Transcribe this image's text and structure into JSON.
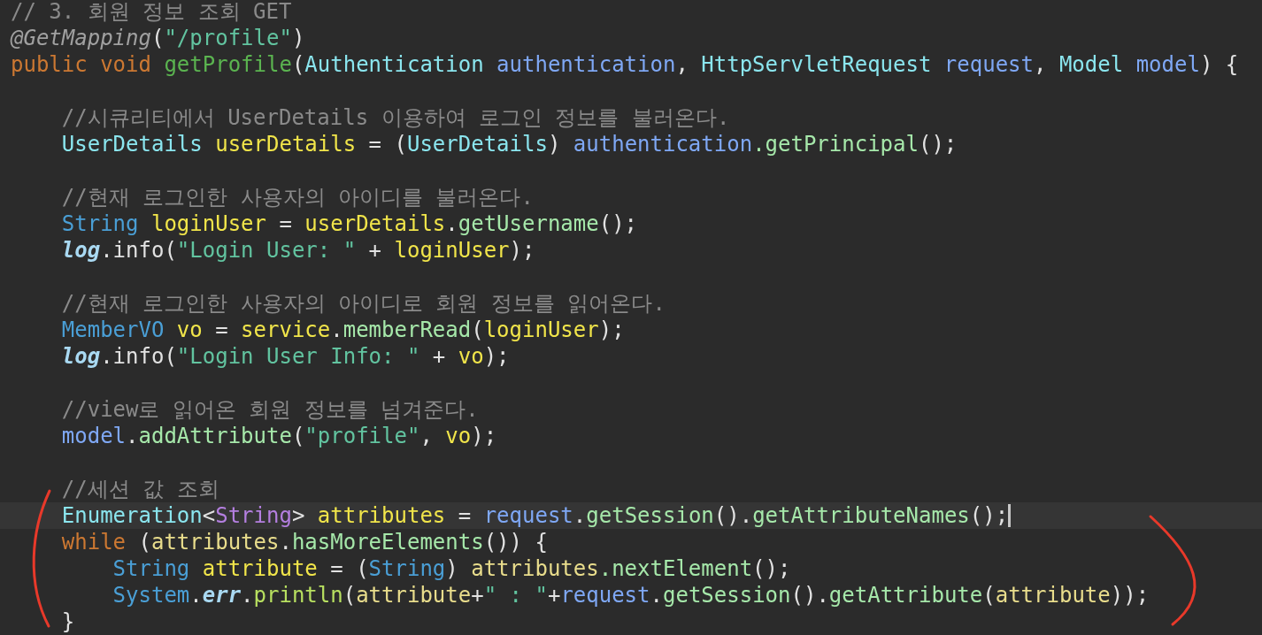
{
  "editor": {
    "lines": [
      {
        "kind": "code",
        "current": false,
        "tokens": [
          {
            "t": "// 3. 회원 정보 조회 GET",
            "kind": "cm"
          }
        ]
      },
      {
        "kind": "code",
        "current": false,
        "tokens": [
          {
            "t": "@GetMapping",
            "kind": "an"
          },
          {
            "t": "(",
            "kind": "p"
          },
          {
            "t": "\"/profile\"",
            "kind": "s"
          },
          {
            "t": ")",
            "kind": "p"
          }
        ]
      },
      {
        "kind": "code",
        "current": false,
        "tokens": [
          {
            "t": "public void",
            "kind": "kw"
          },
          {
            "t": " getProfile",
            "kind": "fn"
          },
          {
            "t": "(",
            "kind": "p"
          },
          {
            "t": "Authentication",
            "kind": "ty"
          },
          {
            "t": " authentication",
            "kind": "pa"
          },
          {
            "t": ",",
            "kind": "p"
          },
          {
            "t": " HttpServletRequest",
            "kind": "ty"
          },
          {
            "t": " request",
            "kind": "pa"
          },
          {
            "t": ",",
            "kind": "p"
          },
          {
            "t": " Model",
            "kind": "ty"
          },
          {
            "t": " model",
            "kind": "pa"
          },
          {
            "t": ") {",
            "kind": "p"
          }
        ]
      },
      {
        "kind": "blank",
        "current": false
      },
      {
        "kind": "code",
        "current": false,
        "tokens": [
          {
            "t": "    //시큐리티에서 UserDetails 이용하여 로그인 정보를 불러온다.",
            "kind": "cm"
          }
        ]
      },
      {
        "kind": "code",
        "current": false,
        "tokens": [
          {
            "t": "    UserDetails",
            "kind": "ty"
          },
          {
            "t": " userDetails",
            "kind": "lv"
          },
          {
            "t": " = (",
            "kind": "p"
          },
          {
            "t": "UserDetails",
            "kind": "ty"
          },
          {
            "t": ")",
            "kind": "p"
          },
          {
            "t": " authentication",
            "kind": "pa"
          },
          {
            "t": ".getPrincipal",
            "kind": "mc"
          },
          {
            "t": "();",
            "kind": "p"
          }
        ]
      },
      {
        "kind": "blank",
        "current": false
      },
      {
        "kind": "code",
        "current": false,
        "tokens": [
          {
            "t": "    //현재 로그인한 사용자의 아이디를 불러온다.",
            "kind": "cm"
          }
        ]
      },
      {
        "kind": "code",
        "current": false,
        "tokens": [
          {
            "t": "    String",
            "kind": "cl"
          },
          {
            "t": " loginUser",
            "kind": "lv"
          },
          {
            "t": " =",
            "kind": "p"
          },
          {
            "t": " userDetails",
            "kind": "lv"
          },
          {
            "t": ".",
            "kind": "p"
          },
          {
            "t": "getUsername",
            "kind": "mc"
          },
          {
            "t": "();",
            "kind": "p"
          }
        ]
      },
      {
        "kind": "code",
        "current": false,
        "tokens": [
          {
            "t": "    log",
            "kind": "sf"
          },
          {
            "t": ".info(",
            "kind": "p"
          },
          {
            "t": "\"Login User: \"",
            "kind": "s"
          },
          {
            "t": " +",
            "kind": "p"
          },
          {
            "t": " loginUser",
            "kind": "lv"
          },
          {
            "t": ");",
            "kind": "p"
          }
        ]
      },
      {
        "kind": "blank",
        "current": false
      },
      {
        "kind": "code",
        "current": false,
        "tokens": [
          {
            "t": "    //현재 로그인한 사용자의 아이디로 회원 정보를 읽어온다.",
            "kind": "cm"
          }
        ]
      },
      {
        "kind": "code",
        "current": false,
        "tokens": [
          {
            "t": "    MemberVO",
            "kind": "cl"
          },
          {
            "t": " vo",
            "kind": "lv"
          },
          {
            "t": " =",
            "kind": "p"
          },
          {
            "t": " service",
            "kind": "lv"
          },
          {
            "t": ".",
            "kind": "p"
          },
          {
            "t": "memberRead",
            "kind": "mc"
          },
          {
            "t": "(",
            "kind": "p"
          },
          {
            "t": "loginUser",
            "kind": "lv"
          },
          {
            "t": ");",
            "kind": "p"
          }
        ]
      },
      {
        "kind": "code",
        "current": false,
        "tokens": [
          {
            "t": "    log",
            "kind": "sf"
          },
          {
            "t": ".info(",
            "kind": "p"
          },
          {
            "t": "\"Login User Info: \"",
            "kind": "s"
          },
          {
            "t": " +",
            "kind": "p"
          },
          {
            "t": " vo",
            "kind": "lv"
          },
          {
            "t": ");",
            "kind": "p"
          }
        ]
      },
      {
        "kind": "blank",
        "current": false
      },
      {
        "kind": "code",
        "current": false,
        "tokens": [
          {
            "t": "    //view로 읽어온 회원 정보를 넘겨준다.",
            "kind": "cm"
          }
        ]
      },
      {
        "kind": "code",
        "current": false,
        "tokens": [
          {
            "t": "    model",
            "kind": "pa"
          },
          {
            "t": ".",
            "kind": "p"
          },
          {
            "t": "addAttribute",
            "kind": "mc"
          },
          {
            "t": "(",
            "kind": "p"
          },
          {
            "t": "\"profile\"",
            "kind": "s"
          },
          {
            "t": ",",
            "kind": "p"
          },
          {
            "t": " vo",
            "kind": "lv"
          },
          {
            "t": ");",
            "kind": "p"
          }
        ]
      },
      {
        "kind": "blank",
        "current": false
      },
      {
        "kind": "code",
        "current": false,
        "tokens": [
          {
            "t": "    //세션 값 조회",
            "kind": "cm"
          }
        ]
      },
      {
        "kind": "code",
        "current": true,
        "tokens": [
          {
            "t": "    Enumeration",
            "kind": "ty"
          },
          {
            "t": "<",
            "kind": "p"
          },
          {
            "t": "String",
            "kind": "gp"
          },
          {
            "t": ">",
            "kind": "p"
          },
          {
            "t": " attributes",
            "kind": "lv"
          },
          {
            "t": " =",
            "kind": "p"
          },
          {
            "t": " request",
            "kind": "pa"
          },
          {
            "t": ".",
            "kind": "p"
          },
          {
            "t": "getSession",
            "kind": "mc"
          },
          {
            "t": "().",
            "kind": "p"
          },
          {
            "t": "getAttributeNames",
            "kind": "mc"
          },
          {
            "t": "();",
            "kind": "p"
          }
        ]
      },
      {
        "kind": "code",
        "current": false,
        "tokens": [
          {
            "t": "    while",
            "kind": "kw"
          },
          {
            "t": " (",
            "kind": "p"
          },
          {
            "t": "attributes",
            "kind": "vu"
          },
          {
            "t": ".",
            "kind": "p"
          },
          {
            "t": "hasMoreElements",
            "kind": "mc"
          },
          {
            "t": "()) {",
            "kind": "p"
          }
        ]
      },
      {
        "kind": "code",
        "current": false,
        "tokens": [
          {
            "t": "        String",
            "kind": "cl"
          },
          {
            "t": " attribute",
            "kind": "lv"
          },
          {
            "t": " = (",
            "kind": "p"
          },
          {
            "t": "String",
            "kind": "cl"
          },
          {
            "t": ")",
            "kind": "p"
          },
          {
            "t": " attributes",
            "kind": "vu"
          },
          {
            "t": ".nextElement",
            "kind": "mc"
          },
          {
            "t": "();",
            "kind": "p"
          }
        ]
      },
      {
        "kind": "code",
        "current": false,
        "tokens": [
          {
            "t": "        System",
            "kind": "cl"
          },
          {
            "t": ".",
            "kind": "p"
          },
          {
            "t": "err",
            "kind": "sf"
          },
          {
            "t": ".",
            "kind": "p"
          },
          {
            "t": "println",
            "kind": "pl"
          },
          {
            "t": "(",
            "kind": "p"
          },
          {
            "t": "attribute",
            "kind": "vu"
          },
          {
            "t": "+",
            "kind": "p"
          },
          {
            "t": "\" : \"",
            "kind": "s"
          },
          {
            "t": "+",
            "kind": "p"
          },
          {
            "t": "request",
            "kind": "pa"
          },
          {
            "t": ".",
            "kind": "p"
          },
          {
            "t": "getSession",
            "kind": "mc"
          },
          {
            "t": "().",
            "kind": "p"
          },
          {
            "t": "getAttribute",
            "kind": "mc"
          },
          {
            "t": "(",
            "kind": "p"
          },
          {
            "t": "attribute",
            "kind": "vu"
          },
          {
            "t": "));",
            "kind": "p"
          }
        ]
      },
      {
        "kind": "code",
        "current": false,
        "tokens": [
          {
            "t": "    }",
            "kind": "p"
          }
        ]
      }
    ]
  }
}
